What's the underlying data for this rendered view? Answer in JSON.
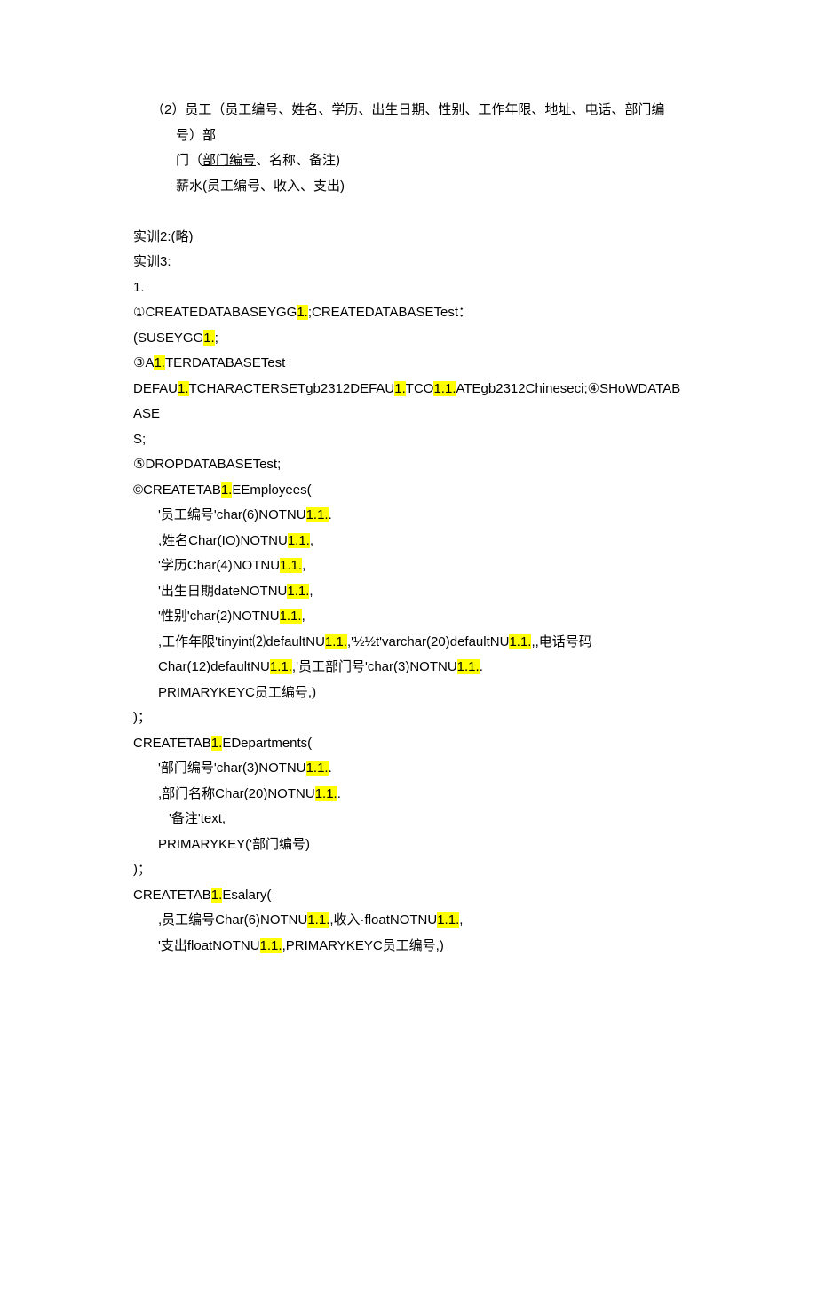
{
  "l01a": "（2）员工（",
  "l01u": "员工编号",
  "l01b": "、姓名、学历、出生日期、性别、工作年限、地址、电话、部门编号）部",
  "l02a": "门（",
  "l02u": "部门编号",
  "l02b": "、名称、备注)",
  "l03": "薪水(员工编号、收入、支出)",
  "blank": " ",
  "l04": "实训2:(略)",
  "l05": "实训3:",
  "l06": "1.",
  "l07a": "①CREATEDATABASEYGG",
  "l07h": "1.",
  "l07b": ";CREATEDATABASETest：",
  "l08a": "(SUSEYGG",
  "l08h": "1.",
  "l08b": ";",
  "l09a": "③A",
  "l09h": "1.",
  "l09b": "TERDATABASETest",
  "l10a": "DEFAU",
  "l10h1": "1.",
  "l10b": "TCHARACTERSETgb2312DEFAU",
  "l10h2": "1.",
  "l10c": "TCO",
  "l10h3": "1.1.",
  "l10d": "ATEgb2312Chineseci;④SHoWDATABASE",
  "l11": "S;",
  "l12": "⑤DROPDATABASETest;",
  "l13a": "©CREATETAB",
  "l13h": "1.",
  "l13b": "EEmployees(",
  "l14a": "'员工编号'char(6)NOTNU",
  "l14h": "1.1.",
  "l14b": ".",
  "l15a": ",姓名Char(IO)NOTNU",
  "l15h": "1.1.",
  "l15b": ",",
  "l16a": "'学历Char(4)NOTNU",
  "l16h": "1.1.",
  "l16b": ",",
  "l17a": "'出生日期dateNOTNU",
  "l17h": "1.1.",
  "l17b": ",",
  "l18a": "'性别'char(2)NOTNU",
  "l18h": "1.1.",
  "l18b": ",",
  "l19a": ",工作年限'tinyint⑵defaultNU",
  "l19h1": "1.1.",
  "l19b": ",'½½t'varchar(20)defaultNU",
  "l19h2": "1.1.",
  "l19c": ",,电话号码",
  "l20a": "Char(12)defaultNU",
  "l20h1": "1.1.",
  "l20b": ",'员工部门号'char(3)NOTNU",
  "l20h2": "1.1.",
  "l20c": ".",
  "l21": "PRIMARYKEYC员工编号,)",
  "l22": ")；",
  "l23a": "CREATETAB",
  "l23h": "1.",
  "l23b": "EDepartments(",
  "l24a": "'部门编号'char(3)NOTNU",
  "l24h": "1.1.",
  "l24b": ".",
  "l25a": ",部门名称Char(20)NOTNU",
  "l25h": "1.1.",
  "l25b": ".",
  "l26": "'备注'text,",
  "l27": "PRIMARYKEY('部门编号)",
  "l28": ")；",
  "l29a": "CREATETAB",
  "l29h": "1.",
  "l29b": "Esalary(",
  "l30a": ",员工编号Char(6)NOTNU",
  "l30h1": "1.1.",
  "l30b": ",收入·floatNOTNU",
  "l30h2": "1.1.",
  "l30c": ",",
  "l31a": "'支出floatNOTNU",
  "l31h": "1.1.",
  "l31b": ",PRIMARYKEYC员工编号,)"
}
